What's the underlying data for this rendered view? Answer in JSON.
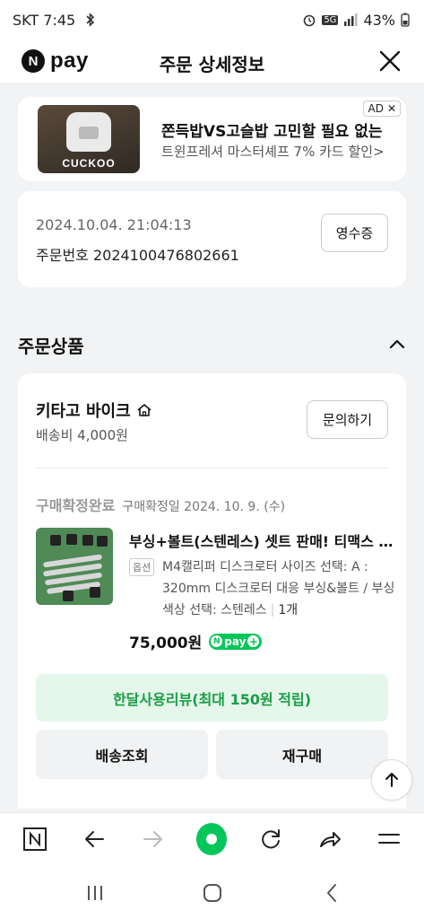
{
  "status_bar": {
    "carrier_time": "SKT 7:45",
    "network": "5G",
    "battery": "43%"
  },
  "app_bar": {
    "logo_text": "pay",
    "title": "주문 상세정보"
  },
  "ad": {
    "image_brand": "CUCKOO",
    "badge": "AD",
    "title": "쫀득밥VS고슬밥 고민할 필요 없는",
    "subtitle": "트윈프레셔 마스터셰프 7% 카드 할인>"
  },
  "order": {
    "datetime": "2024.10.04. 21:04:13",
    "order_number": "주문번호 2024100476802661",
    "receipt_label": "영수증"
  },
  "section": {
    "title": "주문상품"
  },
  "seller": {
    "name": "키타고 바이크",
    "shipping_fee": "배송비 4,000원",
    "inquiry_label": "문의하기"
  },
  "item": {
    "status": "구매확정완료",
    "confirm_date": "구매확정일 2024. 10. 9. (수)",
    "name": "부싱+볼트(스텐레스) 셋트 판매! 티맥스 캘리퍼",
    "option_tag": "옵션",
    "option_text": "M4캘리퍼 디스크로터 사이즈 선택: A : 320mm 디스크로터 대응 부싱&볼트 / 부싱 색상 선택: 스텐레스",
    "quantity": "1개",
    "price": "75,000원",
    "pay_badge": "pay"
  },
  "actions": {
    "review_label": "한달사용리뷰(최대 150원 적립)",
    "shipping_label": "배송조회",
    "rebuy_label": "재구매"
  },
  "colors": {
    "brand_green": "#03c75a",
    "review_bg": "#e4f7ea",
    "review_text": "#1a9e48"
  }
}
